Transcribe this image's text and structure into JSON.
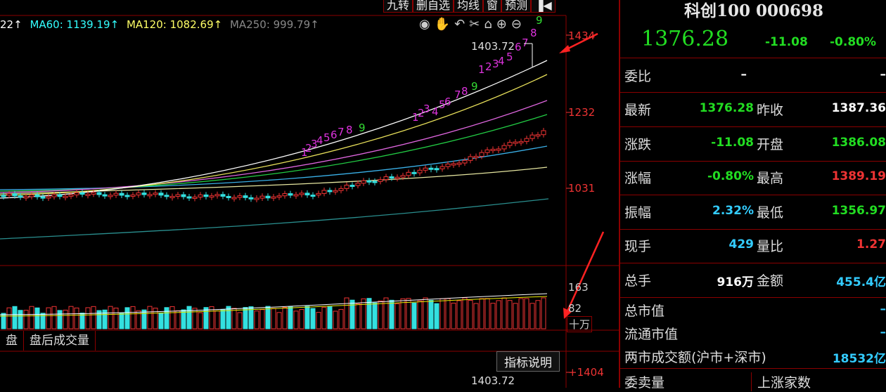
{
  "toolbar": {
    "items": [
      "九转",
      "删自选",
      "均线",
      "窗",
      "预测"
    ]
  },
  "ma_legend": [
    {
      "text": "22↑",
      "color": "#ffffff"
    },
    {
      "text": "MA60: 1139.19↑",
      "color": "#ffffff"
    },
    {
      "text": "MA120: 1082.69↑",
      "color": "#ffffff"
    },
    {
      "text": "MA250: 999.79↑",
      "color": "#ffffff"
    }
  ],
  "price_axis": [
    "1434",
    "1232",
    "1031",
    "+1404"
  ],
  "volume_axis": [
    "163",
    "82",
    "十万"
  ],
  "annotations": {
    "high": "1403.72",
    "high_bottom": "1403.72"
  },
  "tabs": [
    "盘",
    "盘后成交量"
  ],
  "indicator_button": "指标说明",
  "quote": {
    "name": "科创100 000698",
    "price": "1376.28",
    "change": "-11.08",
    "change_pct": "-0.80%",
    "weibi_label": "委比",
    "weibi_v1": "–",
    "weibi_v2": "–",
    "rows": [
      {
        "l1": "最新",
        "v1": "1376.28",
        "c1": "#22dd22",
        "l2": "昨收",
        "v2": "1387.36",
        "c2": "#ffffff"
      },
      {
        "l1": "涨跌",
        "v1": "-11.08",
        "c1": "#22dd22",
        "l2": "开盘",
        "v2": "1386.08",
        "c2": "#22dd22"
      },
      {
        "l1": "涨幅",
        "v1": "-0.80%",
        "c1": "#22dd22",
        "l2": "最高",
        "v2": "1389.19",
        "c2": "#ee3333"
      },
      {
        "l1": "振幅",
        "v1": "2.32%",
        "c1": "#33ccff",
        "l2": "最低",
        "v2": "1356.97",
        "c2": "#22dd22"
      },
      {
        "l1": "现手",
        "v1": "429",
        "c1": "#33ccff",
        "l2": "量比",
        "v2": "1.27",
        "c2": "#ee3333"
      },
      {
        "l1": "总手",
        "v1": "916万",
        "c1": "#ffffff",
        "l2": "金额",
        "v2": "455.4亿",
        "c2": "#33ccff"
      }
    ],
    "mcap_label": "总市值",
    "mcap_value": "–",
    "float_label": "流通市值",
    "float_value": "–",
    "turnover_label": "两市成交额(沪市+深市)",
    "turnover_value": "18532亿",
    "order_label": "委卖量",
    "rise_label": "上涨家数"
  },
  "colors": {
    "up": "#ee3333",
    "down": "#22dd22",
    "cyan": "#33ccff",
    "frame": "#8b0000"
  }
}
